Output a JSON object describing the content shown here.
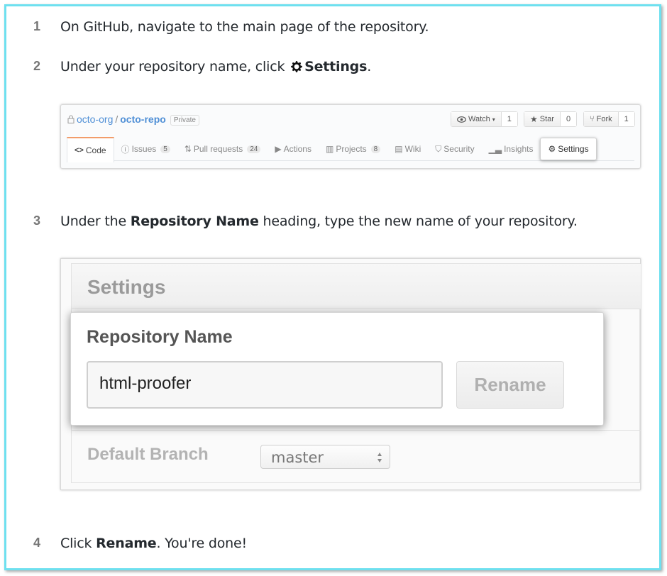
{
  "steps": [
    {
      "num": "1",
      "text": "On GitHub, navigate to the main page of the repository."
    },
    {
      "num": "2",
      "text_before": "Under your repository name, click ",
      "bold": "Settings",
      "text_after": "."
    },
    {
      "num": "3",
      "text_before": "Under the ",
      "bold": "Repository Name",
      "text_after": " heading, type the new name of your repository."
    },
    {
      "num": "4",
      "text_before": "Click ",
      "bold": "Rename",
      "text_after": ". You're done!"
    }
  ],
  "repo_header": {
    "owner": "octo-org",
    "separator": "/",
    "repo": "octo-repo",
    "badge": "Private",
    "watch_label": "Watch",
    "watch_count": "1",
    "star_label": "Star",
    "star_count": "0",
    "fork_label": "Fork",
    "fork_count": "1",
    "tabs": [
      {
        "label": "Code",
        "icon": "code-icon"
      },
      {
        "label": "Issues",
        "count": "5",
        "icon": "issue-icon"
      },
      {
        "label": "Pull requests",
        "count": "24",
        "icon": "pull-request-icon"
      },
      {
        "label": "Actions",
        "icon": "play-icon"
      },
      {
        "label": "Projects",
        "count": "8",
        "icon": "project-icon"
      },
      {
        "label": "Wiki",
        "icon": "book-icon"
      },
      {
        "label": "Security",
        "icon": "shield-icon"
      },
      {
        "label": "Insights",
        "icon": "graph-icon"
      },
      {
        "label": "Settings",
        "icon": "gear-icon"
      }
    ]
  },
  "settings_form": {
    "title": "Settings",
    "repo_name_heading": "Repository Name",
    "repo_name_value": "html-proofer",
    "rename_label": "Rename",
    "default_branch_label": "Default Branch",
    "branch_value": "master"
  },
  "colors": {
    "frame_border": "#6ee0ef",
    "link": "#4f8fd6",
    "active_tab": "#f29c6a"
  }
}
